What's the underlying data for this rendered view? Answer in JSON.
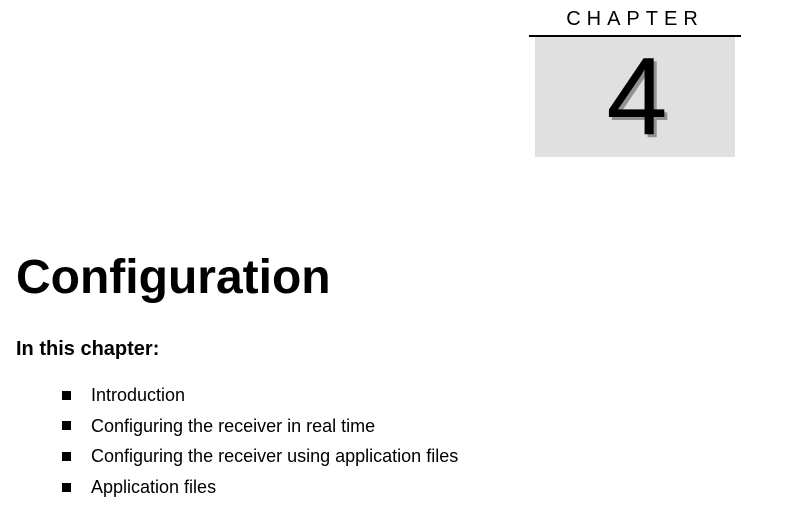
{
  "chapter": {
    "label": "CHAPTER",
    "number": "4"
  },
  "title": "Configuration",
  "section_heading": "In this chapter:",
  "toc": [
    "Introduction",
    "Configuring the receiver in real time",
    "Configuring the receiver using application files",
    "Application files"
  ]
}
